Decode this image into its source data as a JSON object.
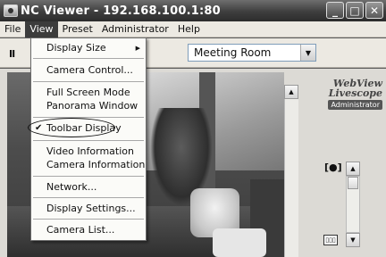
{
  "window": {
    "title": "NC Viewer - 192.168.100.1:80",
    "minimize": "_",
    "maximize": "□",
    "close": "✕"
  },
  "menubar": {
    "items": [
      {
        "label": "File"
      },
      {
        "label": "View"
      },
      {
        "label": "Preset"
      },
      {
        "label": "Administrator"
      },
      {
        "label": "Help"
      }
    ]
  },
  "toolbar": {
    "pause_label": "II",
    "preset_value": "Meeting Room"
  },
  "brand": {
    "line1": "WebView",
    "line2": "Livescope",
    "badge": "Administrator"
  },
  "view_menu": {
    "items": [
      {
        "label": "Display Size",
        "submenu": true
      },
      {
        "label": "Camera Control..."
      },
      {
        "label": "Full Screen Mode"
      },
      {
        "label": "Panorama Window"
      },
      {
        "label": "Toolbar Display",
        "checked": true
      },
      {
        "label": "Video Information"
      },
      {
        "label": "Camera Information"
      },
      {
        "label": "Network..."
      },
      {
        "label": "Display Settings..."
      },
      {
        "label": "Camera List..."
      }
    ]
  },
  "icons": {
    "check": "✔",
    "submenu_arrow": "▶",
    "dropdown_arrow": "▼",
    "scroll_up": "▲",
    "scroll_down": "▼"
  }
}
